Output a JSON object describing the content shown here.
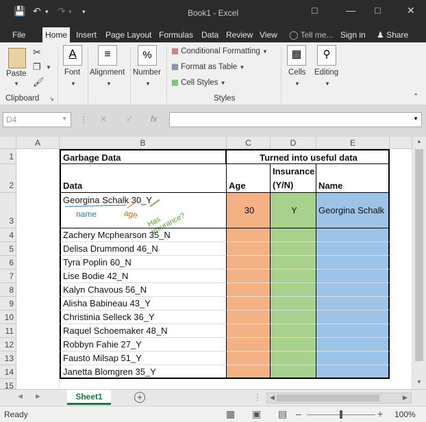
{
  "window": {
    "title": "Book1 - Excel"
  },
  "tabs": [
    {
      "label": "File"
    },
    {
      "label": "Home"
    },
    {
      "label": "Insert"
    },
    {
      "label": "Page Layout"
    },
    {
      "label": "Formulas"
    },
    {
      "label": "Data"
    },
    {
      "label": "Review"
    },
    {
      "label": "View"
    }
  ],
  "tell_me": "Tell me...",
  "sign_in": "Sign in",
  "share": "Share",
  "ribbon": {
    "paste": "Paste",
    "clipboard": "Clipboard",
    "font": "Font",
    "alignment": "Alignment",
    "number": "Number",
    "conditional_formatting": "Conditional Formatting",
    "format_as_table": "Format as Table",
    "cell_styles": "Cell Styles",
    "styles": "Styles",
    "cells": "Cells",
    "editing": "Editing"
  },
  "formula_bar": {
    "name_box": "D4",
    "fx": "fx",
    "value": ""
  },
  "columns": [
    "A",
    "B",
    "C",
    "D",
    "E"
  ],
  "rows": [
    "1",
    "2",
    "3",
    "4",
    "5",
    "6",
    "7",
    "8",
    "9",
    "10",
    "11",
    "12",
    "13",
    "14",
    "15"
  ],
  "sheet": {
    "header_left": "Garbage Data",
    "header_right": "Turned into useful data",
    "col_data": "Data",
    "col_age": "Age",
    "col_insurance": "Insurance (Y/N)",
    "col_name": "Name",
    "example": {
      "data": "Georgina Schalk 30_Y",
      "age": "30",
      "insurance": "Y",
      "name": "Georgina Schalk"
    },
    "annotations": {
      "name": "name",
      "age": "age",
      "insurance": "Has insurance?"
    },
    "data_rows": [
      "Zachery Mcphearson 35_N",
      "Delisa Drummond 46_N",
      "Tyra Poplin 60_N",
      "Lise Bodie 42_N",
      "Kalyn Chavous 56_N",
      "Alisha Babineau 43_Y",
      "Christinia Selleck 36_Y",
      "Raquel Schoemaker 48_N",
      "Robbyn Fahie 27_Y",
      "Fausto Milsap 51_Y",
      "Janetta Blomgren 35_Y"
    ]
  },
  "sheet_tab": "Sheet1",
  "status": {
    "ready": "Ready",
    "zoom": "100%"
  }
}
